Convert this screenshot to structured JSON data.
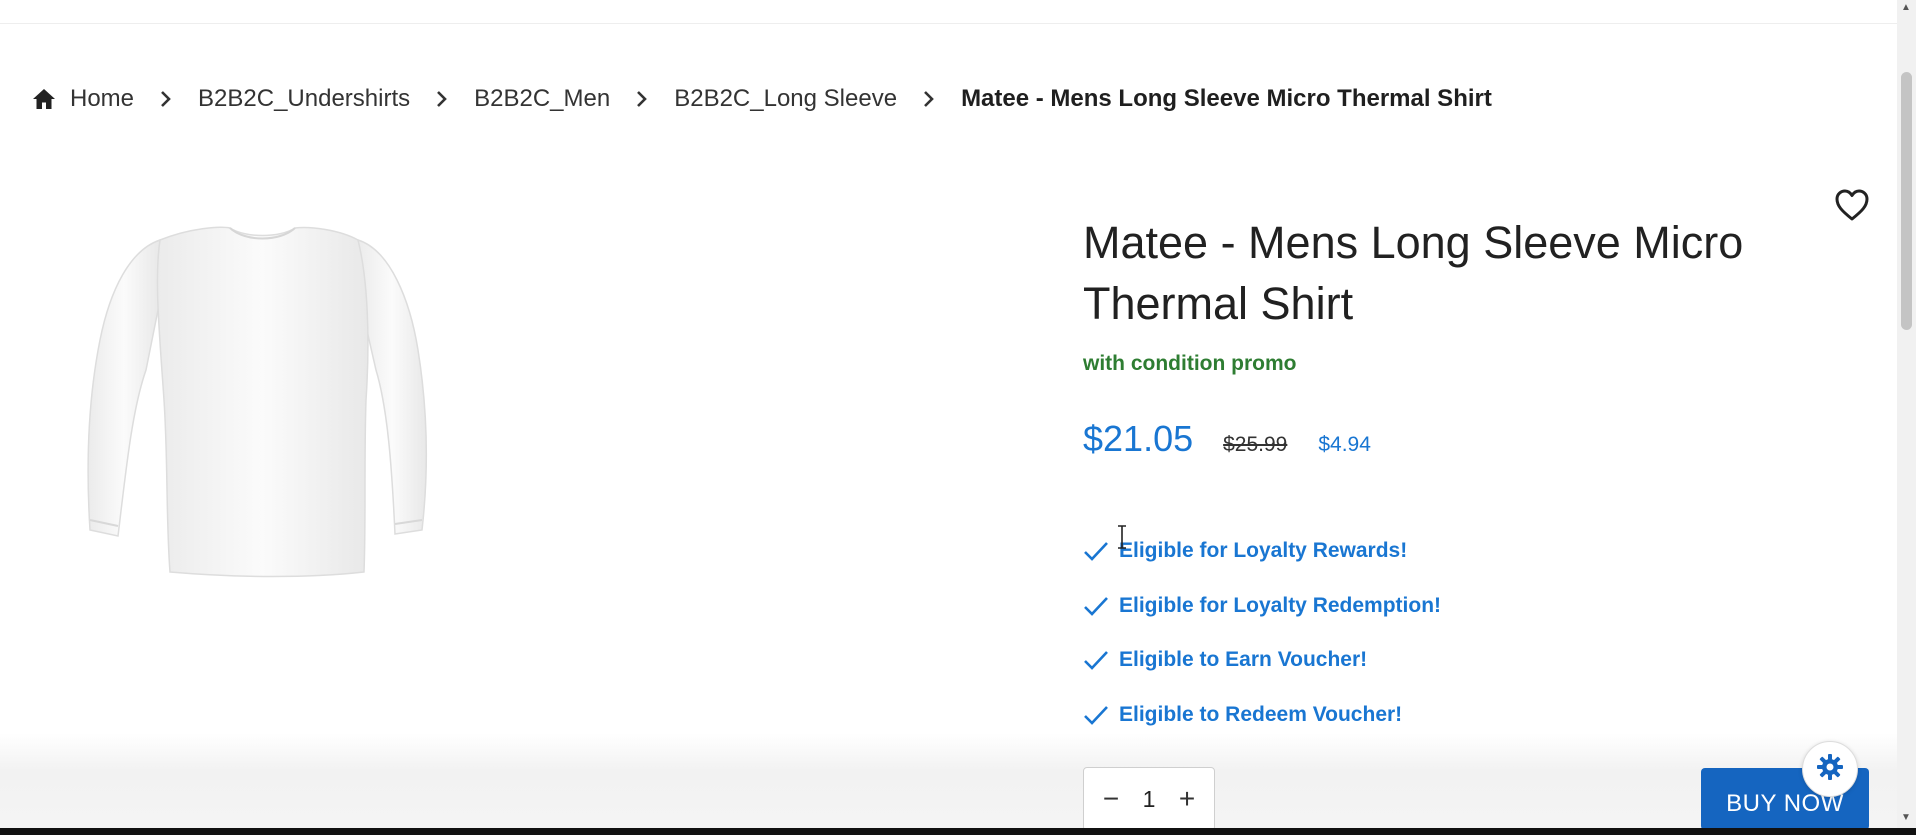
{
  "breadcrumb": {
    "home": "Home",
    "items": [
      "B2B2C_Undershirts",
      "B2B2C_Men",
      "B2B2C_Long Sleeve"
    ],
    "current": "Matee - Mens Long Sleeve Micro Thermal Shirt"
  },
  "product": {
    "title": "Matee - Mens Long Sleeve Micro Thermal Shirt",
    "promo": "with condition promo",
    "price": "$21.05",
    "old_price": "$25.99",
    "saving": "$4.94",
    "eligibility": [
      "Eligible for Loyalty Rewards!",
      "Eligible for Loyalty Redemption!",
      "Eligible to Earn Voucher!",
      "Eligible to Redeem Voucher!"
    ]
  },
  "purchase": {
    "quantity": "1",
    "minus": "−",
    "plus": "+",
    "buy_now": "BUY NOW"
  },
  "icons": {
    "home": "home-icon",
    "chevron": "chevron-right-icon",
    "wishlist": "heart-outline-icon",
    "check": "check-icon",
    "settings": "gear-icon"
  },
  "colors": {
    "accent": "#1976d2",
    "promo": "#2e7d32",
    "button": "#1565c0"
  }
}
